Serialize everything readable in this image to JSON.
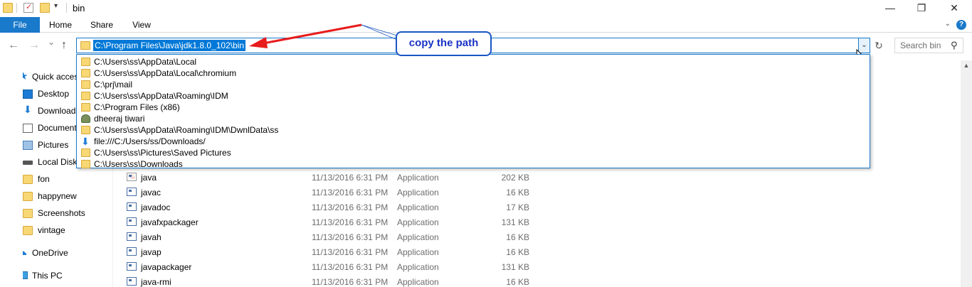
{
  "window": {
    "title": "bin",
    "min": "—",
    "max": "❐",
    "close": "✕"
  },
  "ribbon": {
    "tabs": [
      "File",
      "Home",
      "Share",
      "View"
    ],
    "help": "?"
  },
  "nav": {
    "back": "←",
    "forward": "→",
    "recent": "⌄",
    "up": "↑",
    "address": "C:\\Program Files\\Java\\jdk1.8.0_102\\bin",
    "dropdown_glyph": "⌄",
    "refresh_glyph": "↻",
    "search_placeholder": "Search bin",
    "search_glyph": "⚲"
  },
  "address_history": [
    {
      "text": "C:\\Users\\ss\\AppData\\Local",
      "icon": "folder-icon"
    },
    {
      "text": "C:\\Users\\ss\\AppData\\Local\\chromium",
      "icon": "folder-icon"
    },
    {
      "text": "C:\\prj\\mail",
      "icon": "folder-icon"
    },
    {
      "text": "C:\\Users\\ss\\AppData\\Roaming\\IDM",
      "icon": "folder-icon"
    },
    {
      "text": "C:\\Program Files (x86)",
      "icon": "folder-icon"
    },
    {
      "text": "dheeraj tiwari",
      "icon": "user-icon"
    },
    {
      "text": "C:\\Users\\ss\\AppData\\Roaming\\IDM\\DwnlData\\ss",
      "icon": "folder-icon"
    },
    {
      "text": "file:///C:/Users/ss/Downloads/",
      "icon": "download-icon"
    },
    {
      "text": "C:\\Users\\ss\\Pictures\\Saved Pictures",
      "icon": "folder-icon"
    },
    {
      "text": "C:\\Users\\ss\\Downloads",
      "icon": "folder-icon"
    }
  ],
  "annotation": {
    "callout": "copy the path",
    "arrow_color": "#e81c1c",
    "callout_color": "#1a56c4"
  },
  "sidebar": [
    {
      "label": "Quick access",
      "icon": "star-icon"
    },
    {
      "label": "Desktop",
      "icon": "desktop-icon"
    },
    {
      "label": "Downloads",
      "icon": "download-icon"
    },
    {
      "label": "Documents",
      "icon": "document-icon"
    },
    {
      "label": "Pictures",
      "icon": "pictures-icon"
    },
    {
      "label": "Local Disk (C:)",
      "icon": "disk-icon"
    },
    {
      "label": "fon",
      "icon": "folder-icon"
    },
    {
      "label": "happynew",
      "icon": "folder-icon"
    },
    {
      "label": "Screenshots",
      "icon": "folder-icon"
    },
    {
      "label": "vintage",
      "icon": "folder-icon"
    },
    {
      "label": "OneDrive",
      "icon": "cloud-icon"
    },
    {
      "label": "This PC",
      "icon": "computer-icon"
    }
  ],
  "files": [
    {
      "name": "java",
      "date": "11/13/2016 6:31 PM",
      "type": "Application",
      "size": "202 KB",
      "icon": "java-icon"
    },
    {
      "name": "javac",
      "date": "11/13/2016 6:31 PM",
      "type": "Application",
      "size": "16 KB",
      "icon": "app-icon"
    },
    {
      "name": "javadoc",
      "date": "11/13/2016 6:31 PM",
      "type": "Application",
      "size": "17 KB",
      "icon": "app-icon"
    },
    {
      "name": "javafxpackager",
      "date": "11/13/2016 6:31 PM",
      "type": "Application",
      "size": "131 KB",
      "icon": "app-icon"
    },
    {
      "name": "javah",
      "date": "11/13/2016 6:31 PM",
      "type": "Application",
      "size": "16 KB",
      "icon": "app-icon"
    },
    {
      "name": "javap",
      "date": "11/13/2016 6:31 PM",
      "type": "Application",
      "size": "16 KB",
      "icon": "app-icon"
    },
    {
      "name": "javapackager",
      "date": "11/13/2016 6:31 PM",
      "type": "Application",
      "size": "131 KB",
      "icon": "app-icon"
    },
    {
      "name": "java-rmi",
      "date": "11/13/2016 6:31 PM",
      "type": "Application",
      "size": "16 KB",
      "icon": "app-icon"
    }
  ],
  "colors": {
    "accent": "#1979ca",
    "selection": "#0078d7",
    "folder": "#f8d775"
  }
}
